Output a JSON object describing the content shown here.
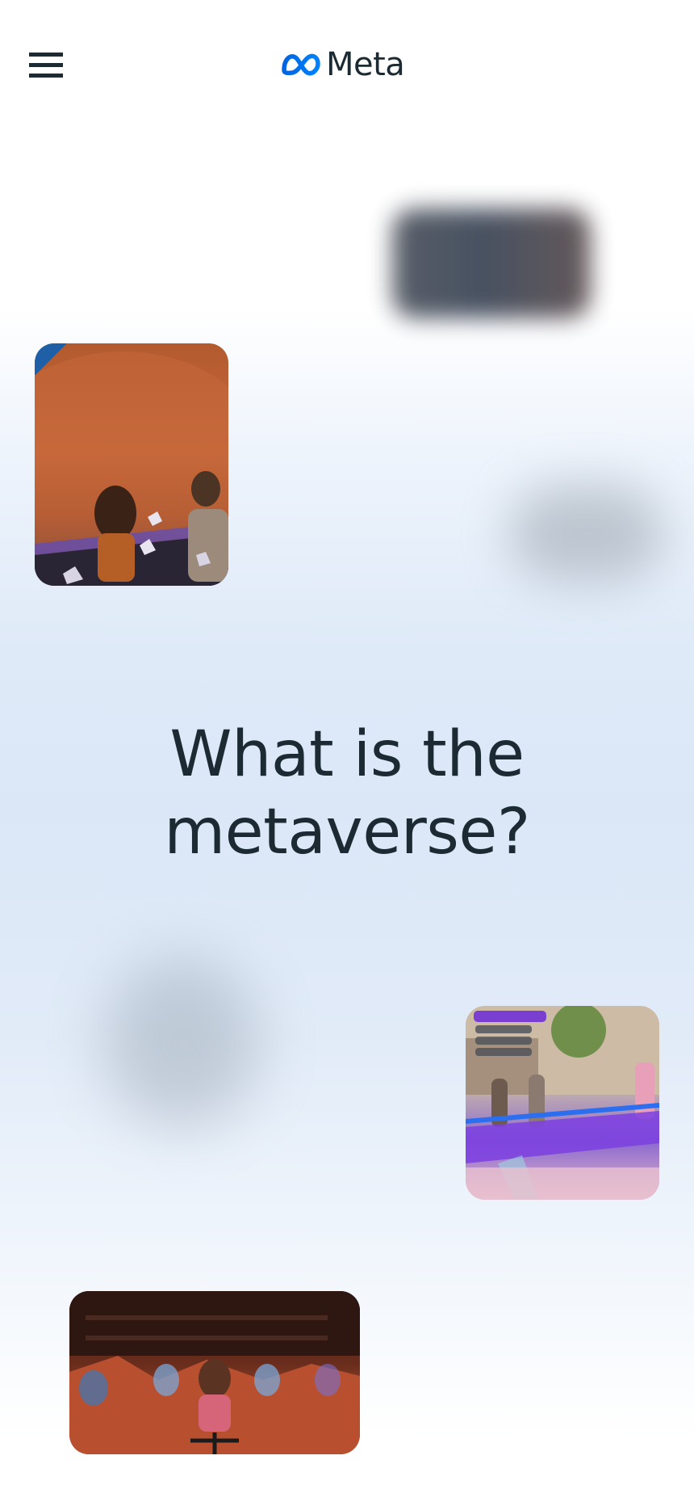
{
  "header": {
    "menu_icon": "hamburger-menu-icon",
    "logo_icon": "meta-infinity-logo-icon",
    "logo_text": "Meta",
    "logo_color": "#0866ff"
  },
  "hero": {
    "title_line1": "What is the",
    "title_line2": "metaverse?",
    "title_color": "#1c2b33"
  },
  "media": {
    "blurred_tiles": 3,
    "image_cards": [
      "mars-viewing-card",
      "ping-pong-card",
      "cycling-class-card"
    ]
  }
}
